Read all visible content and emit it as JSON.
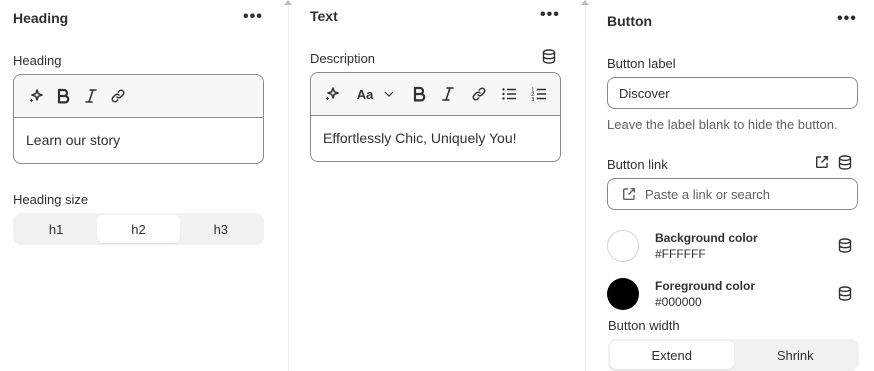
{
  "heading_panel": {
    "title": "Heading",
    "more": "•••",
    "field_label": "Heading",
    "value": "Learn our story",
    "size_label": "Heading size",
    "sizes": [
      "h1",
      "h2",
      "h3"
    ],
    "selected_size": "h2"
  },
  "text_panel": {
    "title": "Text",
    "more": "•••",
    "field_label": "Description",
    "value": "Effortlessly Chic, Uniquely You!",
    "font_size_glyph": "Aa"
  },
  "button_panel": {
    "title": "Button",
    "more": "•••",
    "label_label": "Button label",
    "label_value": "Discover",
    "label_help": "Leave the label blank to hide the button.",
    "link_label": "Button link",
    "link_placeholder": "Paste a link or search",
    "background": {
      "title": "Background color",
      "hex": "#FFFFFF",
      "color": "#FFFFFF"
    },
    "foreground": {
      "title": "Foreground color",
      "hex": "#000000",
      "color": "#000000"
    },
    "width_label": "Button width",
    "widths": [
      "Extend",
      "Shrink"
    ],
    "selected_width": "Extend"
  },
  "icons": [
    "ai-sparkle-icon",
    "bold-icon",
    "italic-icon",
    "link-icon",
    "font-size-icon",
    "chevron-down-icon",
    "bullet-list-icon",
    "numbered-list-icon",
    "dynamic-source-icon",
    "external-link-icon"
  ]
}
